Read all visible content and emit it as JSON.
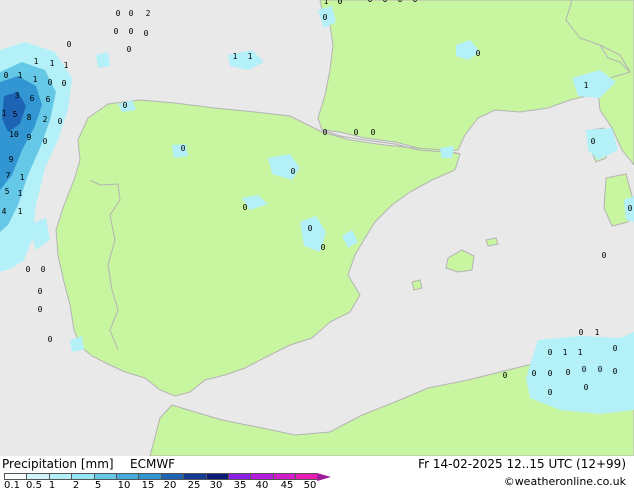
{
  "map": {
    "sea_color": "#e9e9e9",
    "land_color": "#c8f5a0",
    "border_color": "#b4b4b4",
    "precip_colors": {
      "light": "#b4f0f8",
      "mid": "#64c8e6",
      "heavy": "#3296d2",
      "core": "#1e64b4"
    },
    "value_labels": [
      {
        "t": "0"
      },
      {
        "t": "0"
      },
      {
        "t": "2"
      },
      {
        "t": "0"
      },
      {
        "t": "0"
      },
      {
        "t": "0"
      },
      {
        "t": "0"
      },
      {
        "t": "0"
      },
      {
        "t": "1"
      },
      {
        "t": "1"
      },
      {
        "t": "1"
      },
      {
        "t": "0"
      },
      {
        "t": "1"
      },
      {
        "t": "1"
      },
      {
        "t": "0"
      },
      {
        "t": "0"
      },
      {
        "t": "3"
      },
      {
        "t": "6"
      },
      {
        "t": "6"
      },
      {
        "t": "1"
      },
      {
        "t": "5"
      },
      {
        "t": "8"
      },
      {
        "t": "2"
      },
      {
        "t": "0"
      },
      {
        "t": "10"
      },
      {
        "t": "9"
      },
      {
        "t": "0"
      },
      {
        "t": "9"
      },
      {
        "t": "7"
      },
      {
        "t": "1"
      },
      {
        "t": "5"
      },
      {
        "t": "1"
      },
      {
        "t": "4"
      },
      {
        "t": "1"
      },
      {
        "t": "0"
      },
      {
        "t": "0"
      },
      {
        "t": "0"
      },
      {
        "t": "0"
      },
      {
        "t": "0"
      },
      {
        "t": "1"
      },
      {
        "t": "0"
      },
      {
        "t": "0"
      },
      {
        "t": "0"
      },
      {
        "t": "0"
      },
      {
        "t": "0"
      },
      {
        "t": "0"
      },
      {
        "t": "0"
      },
      {
        "t": "0"
      },
      {
        "t": "0"
      },
      {
        "t": "0"
      },
      {
        "t": "1"
      },
      {
        "t": "1"
      },
      {
        "t": "0"
      },
      {
        "t": "0"
      },
      {
        "t": "0"
      },
      {
        "t": "0"
      },
      {
        "t": "0"
      },
      {
        "t": "0"
      },
      {
        "t": "1"
      },
      {
        "t": "0"
      },
      {
        "t": "0"
      },
      {
        "t": "0"
      },
      {
        "t": "0"
      },
      {
        "t": "1"
      },
      {
        "t": "0"
      },
      {
        "t": "1"
      },
      {
        "t": "1"
      },
      {
        "t": "0"
      },
      {
        "t": "0"
      },
      {
        "t": "0"
      },
      {
        "t": "0"
      },
      {
        "t": "0"
      },
      {
        "t": "0"
      },
      {
        "t": "0"
      },
      {
        "t": "0"
      },
      {
        "t": "0"
      },
      {
        "t": "0"
      }
    ]
  },
  "footer": {
    "legend_title": "Precipitation [mm]",
    "model": "ECMWF",
    "run_info": "Fr 14-02-2025 12..15 UTC (12+99)",
    "copyright": "©weatheronline.co.uk",
    "legend": {
      "ticks": [
        "0.1",
        "0.5",
        "1",
        "2",
        "5",
        "10",
        "15",
        "20",
        "25",
        "30",
        "35",
        "40",
        "45",
        "50"
      ],
      "colors": [
        "#f8fcfc",
        "#d2f5fa",
        "#b4f0f8",
        "#96e6f5",
        "#64c8e6",
        "#46aadc",
        "#3296d2",
        "#1e64b4",
        "#143c96",
        "#0a1e78",
        "#8c1ee6",
        "#b41edc",
        "#d21ec8",
        "#e61eb4"
      ],
      "arrow_color": "#a01a9a"
    }
  }
}
